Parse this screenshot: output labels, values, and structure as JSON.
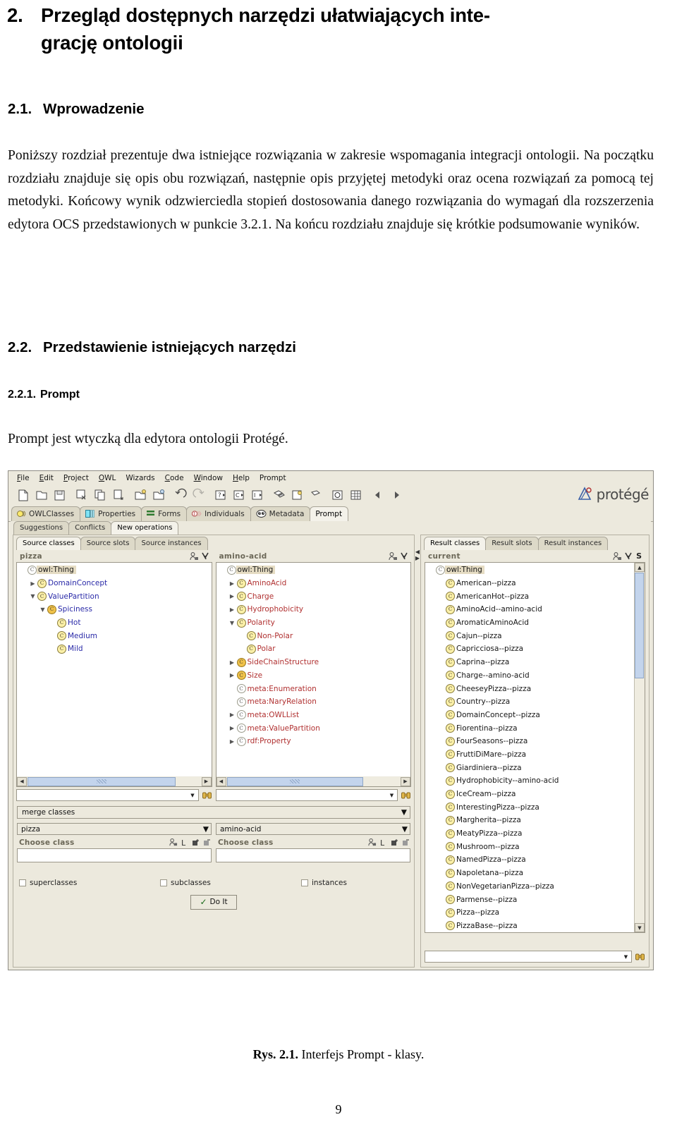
{
  "document": {
    "chapter": {
      "number": "2.",
      "line1": "Przegląd dostępnych narzędzi ułatwiających inte-",
      "line2": "grację ontologii"
    },
    "section_21": {
      "number": "2.1.",
      "title": "Wprowadzenie"
    },
    "paragraph_intro": "Poniższy rozdział prezentuje dwa istniejące rozwiązania w zakresie wspomagania integracji ontologii. Na początku rozdziału znajduje się opis obu rozwiązań, następnie opis przyjętej metodyki oraz ocena rozwiązań za pomocą tej metodyki. Końcowy wynik odzwierciedla stopień dostosowania danego rozwiązania do wymagań dla rozszerzenia edytora OCS przedstawionych w punkcie 3.2.1. Na końcu rozdziału znajduje się krótkie podsumowanie wyników.",
    "section_22": {
      "number": "2.2.",
      "title": "Przedstawienie istniejących narzędzi"
    },
    "section_221": {
      "number": "2.2.1.",
      "title": "Prompt"
    },
    "paragraph_prompt": "Prompt jest wtyczką dla edytora ontologii Protégé.",
    "figure_caption_label": "Rys. 2.1.",
    "figure_caption_text": "Interfejs Prompt - klasy.",
    "page_number": "9"
  },
  "screenshot": {
    "menu": [
      "File",
      "Edit",
      "Project",
      "OWL",
      "Wizards",
      "Code",
      "Window",
      "Help",
      "Prompt"
    ],
    "logo_text": "protégé",
    "main_tabs": [
      {
        "label": "OWLClasses",
        "icon": "owl-classes-icon",
        "active": false
      },
      {
        "label": "Properties",
        "icon": "properties-icon",
        "active": false
      },
      {
        "label": "Forms",
        "icon": "forms-icon",
        "active": false
      },
      {
        "label": "Individuals",
        "icon": "individuals-icon",
        "active": false
      },
      {
        "label": "Metadata",
        "icon": "metadata-icon",
        "active": false
      },
      {
        "label": "Prompt",
        "icon": "",
        "active": true
      }
    ],
    "prompt_tabs": [
      {
        "label": "Suggestions",
        "active": false
      },
      {
        "label": "Conflicts",
        "active": false
      },
      {
        "label": "New operations",
        "active": true
      }
    ],
    "source_tabs": [
      {
        "label": "Source classes",
        "active": true
      },
      {
        "label": "Source slots",
        "active": false
      },
      {
        "label": "Source instances",
        "active": false
      }
    ],
    "result_tabs": [
      {
        "label": "Result classes",
        "active": true
      },
      {
        "label": "Result slots",
        "active": false
      },
      {
        "label": "Result instances",
        "active": false
      }
    ],
    "left_tree": {
      "title": "pizza",
      "nodes": [
        {
          "label": "owl:Thing",
          "indent": 0,
          "twisty": "",
          "icon": "white",
          "selected": true
        },
        {
          "label": "DomainConcept",
          "indent": 1,
          "twisty": "collapsed",
          "icon": "yellow",
          "selected": false
        },
        {
          "label": "ValuePartition",
          "indent": 1,
          "twisty": "expanded",
          "icon": "yellow",
          "selected": false
        },
        {
          "label": "Spiciness",
          "indent": 2,
          "twisty": "expanded",
          "icon": "orange",
          "selected": false
        },
        {
          "label": "Hot",
          "indent": 3,
          "twisty": "",
          "icon": "yellow",
          "selected": false
        },
        {
          "label": "Medium",
          "indent": 3,
          "twisty": "",
          "icon": "yellow",
          "selected": false
        },
        {
          "label": "Mild",
          "indent": 3,
          "twisty": "",
          "icon": "yellow",
          "selected": false
        }
      ],
      "combo_value": ""
    },
    "mid_tree": {
      "title": "amino-acid",
      "nodes": [
        {
          "label": "owl:Thing",
          "indent": 0,
          "twisty": "",
          "icon": "white",
          "selected": true
        },
        {
          "label": "AminoAcid",
          "indent": 1,
          "twisty": "collapsed",
          "icon": "yellow",
          "selected": false
        },
        {
          "label": "Charge",
          "indent": 1,
          "twisty": "collapsed",
          "icon": "yellow",
          "selected": false
        },
        {
          "label": "Hydrophobicity",
          "indent": 1,
          "twisty": "collapsed",
          "icon": "yellow",
          "selected": false
        },
        {
          "label": "Polarity",
          "indent": 1,
          "twisty": "expanded",
          "icon": "yellow",
          "selected": false
        },
        {
          "label": "Non-Polar",
          "indent": 2,
          "twisty": "",
          "icon": "yellow",
          "selected": false
        },
        {
          "label": "Polar",
          "indent": 2,
          "twisty": "",
          "icon": "yellow",
          "selected": false
        },
        {
          "label": "SideChainStructure",
          "indent": 1,
          "twisty": "collapsed",
          "icon": "orange",
          "selected": false
        },
        {
          "label": "Size",
          "indent": 1,
          "twisty": "collapsed",
          "icon": "orange",
          "selected": false
        },
        {
          "label": "meta:Enumeration",
          "indent": 1,
          "twisty": "",
          "icon": "white",
          "selected": false
        },
        {
          "label": "meta:NaryRelation",
          "indent": 1,
          "twisty": "",
          "icon": "white",
          "selected": false
        },
        {
          "label": "meta:OWLList",
          "indent": 1,
          "twisty": "collapsed",
          "icon": "white",
          "selected": false
        },
        {
          "label": "meta:ValuePartition",
          "indent": 1,
          "twisty": "collapsed",
          "icon": "white",
          "selected": false
        },
        {
          "label": "rdf:Property",
          "indent": 1,
          "twisty": "collapsed",
          "icon": "white",
          "selected": false
        }
      ],
      "combo_value": ""
    },
    "operation_combo": "merge classes",
    "choose_left": {
      "ontology": "pizza",
      "label": "Choose class",
      "field_value": ""
    },
    "choose_right": {
      "ontology": "amino-acid",
      "label": "Choose class",
      "field_value": ""
    },
    "checkboxes": [
      {
        "label": "superclasses",
        "checked": false
      },
      {
        "label": "subclasses",
        "checked": false
      },
      {
        "label": "instances",
        "checked": false
      }
    ],
    "do_it_label": "Do It",
    "result_tree": {
      "title": "current",
      "nodes": [
        {
          "label": "owl:Thing",
          "indent": 0,
          "icon": "white",
          "selected": true
        },
        {
          "label": "American--pizza",
          "indent": 1,
          "icon": "yellow",
          "selected": false
        },
        {
          "label": "AmericanHot--pizza",
          "indent": 1,
          "icon": "yellow",
          "selected": false
        },
        {
          "label": "AminoAcid--amino-acid",
          "indent": 1,
          "icon": "yellow",
          "selected": false
        },
        {
          "label": "AromaticAminoAcid",
          "indent": 1,
          "icon": "yellow",
          "selected": false
        },
        {
          "label": "Cajun--pizza",
          "indent": 1,
          "icon": "yellow",
          "selected": false
        },
        {
          "label": "Capricciosa--pizza",
          "indent": 1,
          "icon": "yellow",
          "selected": false
        },
        {
          "label": "Caprina--pizza",
          "indent": 1,
          "icon": "yellow",
          "selected": false
        },
        {
          "label": "Charge--amino-acid",
          "indent": 1,
          "icon": "yellow",
          "selected": false
        },
        {
          "label": "CheeseyPizza--pizza",
          "indent": 1,
          "icon": "yellow",
          "selected": false
        },
        {
          "label": "Country--pizza",
          "indent": 1,
          "icon": "yellow",
          "selected": false
        },
        {
          "label": "DomainConcept--pizza",
          "indent": 1,
          "icon": "yellow",
          "selected": false
        },
        {
          "label": "Fiorentina--pizza",
          "indent": 1,
          "icon": "yellow",
          "selected": false
        },
        {
          "label": "FourSeasons--pizza",
          "indent": 1,
          "icon": "yellow",
          "selected": false
        },
        {
          "label": "FruttiDiMare--pizza",
          "indent": 1,
          "icon": "yellow",
          "selected": false
        },
        {
          "label": "Giardiniera--pizza",
          "indent": 1,
          "icon": "yellow",
          "selected": false
        },
        {
          "label": "Hydrophobicity--amino-acid",
          "indent": 1,
          "icon": "yellow",
          "selected": false
        },
        {
          "label": "IceCream--pizza",
          "indent": 1,
          "icon": "yellow",
          "selected": false
        },
        {
          "label": "InterestingPizza--pizza",
          "indent": 1,
          "icon": "yellow",
          "selected": false
        },
        {
          "label": "Margherita--pizza",
          "indent": 1,
          "icon": "yellow",
          "selected": false
        },
        {
          "label": "MeatyPizza--pizza",
          "indent": 1,
          "icon": "yellow",
          "selected": false
        },
        {
          "label": "Mushroom--pizza",
          "indent": 1,
          "icon": "yellow",
          "selected": false
        },
        {
          "label": "NamedPizza--pizza",
          "indent": 1,
          "icon": "yellow",
          "selected": false
        },
        {
          "label": "Napoletana--pizza",
          "indent": 1,
          "icon": "yellow",
          "selected": false
        },
        {
          "label": "NonVegetarianPizza--pizza",
          "indent": 1,
          "icon": "yellow",
          "selected": false
        },
        {
          "label": "Parmense--pizza",
          "indent": 1,
          "icon": "yellow",
          "selected": false
        },
        {
          "label": "Pizza--pizza",
          "indent": 1,
          "icon": "yellow",
          "selected": false
        },
        {
          "label": "PizzaBase--pizza",
          "indent": 1,
          "icon": "yellow",
          "selected": false
        }
      ],
      "combo_value": "",
      "badge": "S"
    }
  }
}
